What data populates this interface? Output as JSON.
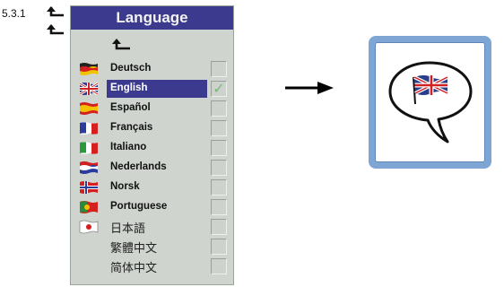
{
  "step_label": "5.3.1",
  "menu": {
    "title": "Language",
    "languages": [
      {
        "label": "Deutsch",
        "flag": "german-flag",
        "checked": false,
        "selected": false
      },
      {
        "label": "English",
        "flag": "uk-flag",
        "checked": true,
        "selected": true
      },
      {
        "label": "Español",
        "flag": "spanish-flag",
        "checked": false,
        "selected": false
      },
      {
        "label": "Français",
        "flag": "french-flag",
        "checked": false,
        "selected": false
      },
      {
        "label": "Italiano",
        "flag": "italian-flag",
        "checked": false,
        "selected": false
      },
      {
        "label": "Nederlands",
        "flag": "dutch-flag",
        "checked": false,
        "selected": false
      },
      {
        "label": "Norsk",
        "flag": "norwegian-flag",
        "checked": false,
        "selected": false
      },
      {
        "label": "Portuguese",
        "flag": "portuguese-flag",
        "checked": false,
        "selected": false
      },
      {
        "label": "日本語",
        "flag": "japanese-flag",
        "checked": false,
        "selected": false
      },
      {
        "label": "繁體中文",
        "flag": "",
        "checked": false,
        "selected": false
      },
      {
        "label": "简体中文",
        "flag": "",
        "checked": false,
        "selected": false
      }
    ]
  },
  "check_mark": "✓",
  "colors": {
    "title_bar": "#3c3a8e",
    "menu_bg": "#cfd4cf",
    "icon_frame": "#7ea5d4"
  }
}
